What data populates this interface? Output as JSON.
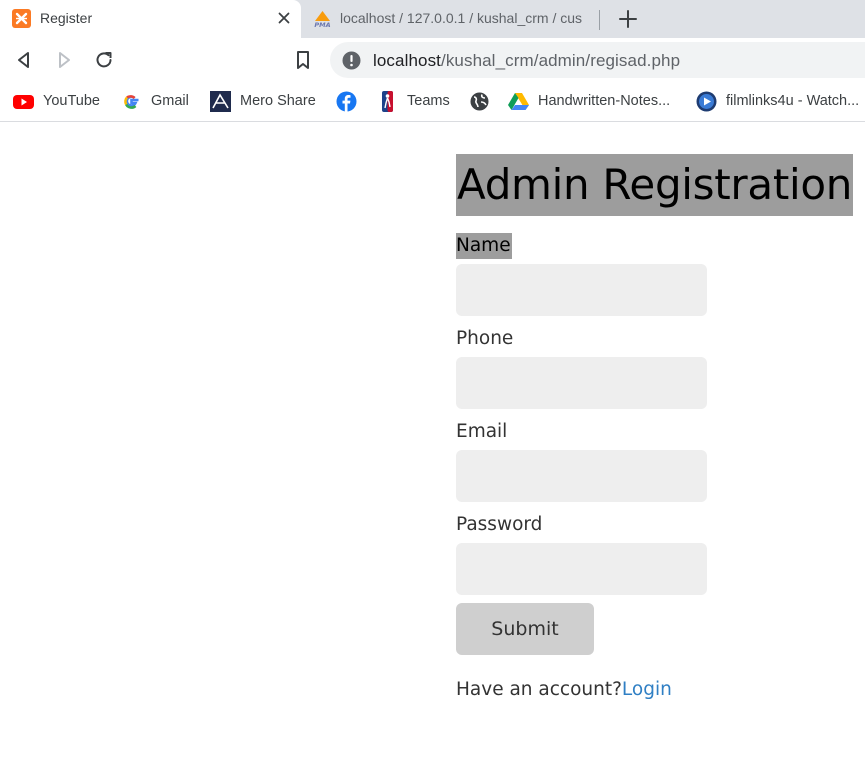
{
  "browser": {
    "tabs": [
      {
        "title": "Register",
        "active": true,
        "icon": "xampp-icon"
      },
      {
        "title": "localhost / 127.0.0.1 / kushal_crm / cus",
        "active": false,
        "icon": "phpmyadmin-icon"
      }
    ],
    "address": {
      "host": "localhost",
      "path": "/kushal_crm/admin/regisad.php"
    },
    "bookmarks": [
      {
        "label": "YouTube",
        "icon": "youtube-icon"
      },
      {
        "label": "Gmail",
        "icon": "google-icon"
      },
      {
        "label": "Mero Share",
        "icon": "meroshare-icon"
      },
      {
        "label": "",
        "icon": "facebook-icon"
      },
      {
        "label": "Teams",
        "icon": "nba-icon"
      },
      {
        "label": "",
        "icon": "globe-icon"
      },
      {
        "label": "Handwritten-Notes...",
        "icon": "google-drive-icon"
      },
      {
        "label": "filmlinks4u - Watch...",
        "icon": "filmlinks-icon"
      }
    ]
  },
  "form": {
    "title": "Admin Registration",
    "fields": [
      {
        "label": "Name",
        "value": ""
      },
      {
        "label": "Phone",
        "value": ""
      },
      {
        "label": "Email",
        "value": ""
      },
      {
        "label": "Password",
        "value": ""
      }
    ],
    "submit_label": "Submit",
    "footer_text": "Have an account?",
    "login_link": "Login"
  },
  "colors": {
    "title_bg": "#9d9d9d",
    "input_bg": "#eeeeee",
    "button_bg": "#cfcfcf",
    "link": "#2f7fc4"
  }
}
